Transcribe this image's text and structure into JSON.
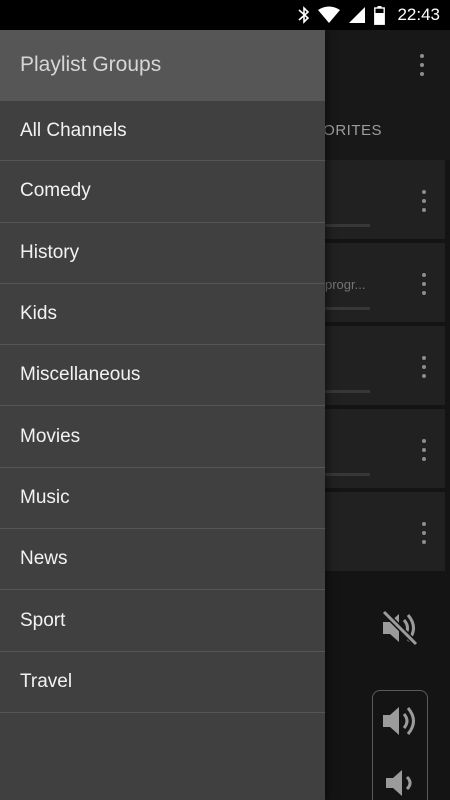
{
  "status_bar": {
    "time": "22:43",
    "icons": [
      "bluetooth-icon",
      "wifi-icon",
      "cell-signal-icon",
      "battery-icon"
    ]
  },
  "app": {
    "tab_label": "ORITES",
    "rows": [
      {
        "subtitle": ""
      },
      {
        "subtitle": "progr..."
      },
      {
        "subtitle": ""
      },
      {
        "subtitle": ""
      },
      {
        "subtitle": ""
      }
    ],
    "icons": [
      "overflow-menu-icon",
      "mute-icon",
      "volume-up-icon",
      "volume-down-icon"
    ]
  },
  "drawer": {
    "title": "Playlist Groups",
    "items": [
      {
        "label": "All Channels"
      },
      {
        "label": "Comedy"
      },
      {
        "label": "History"
      },
      {
        "label": "Kids"
      },
      {
        "label": "Miscellaneous"
      },
      {
        "label": "Movies"
      },
      {
        "label": "Music"
      },
      {
        "label": "News"
      },
      {
        "label": "Sport"
      },
      {
        "label": "Travel"
      }
    ]
  },
  "colors": {
    "drawer_bg": "#404040",
    "drawer_header_bg": "#565656",
    "status_bar_bg": "#000000",
    "text_primary": "#f2f2f2"
  }
}
